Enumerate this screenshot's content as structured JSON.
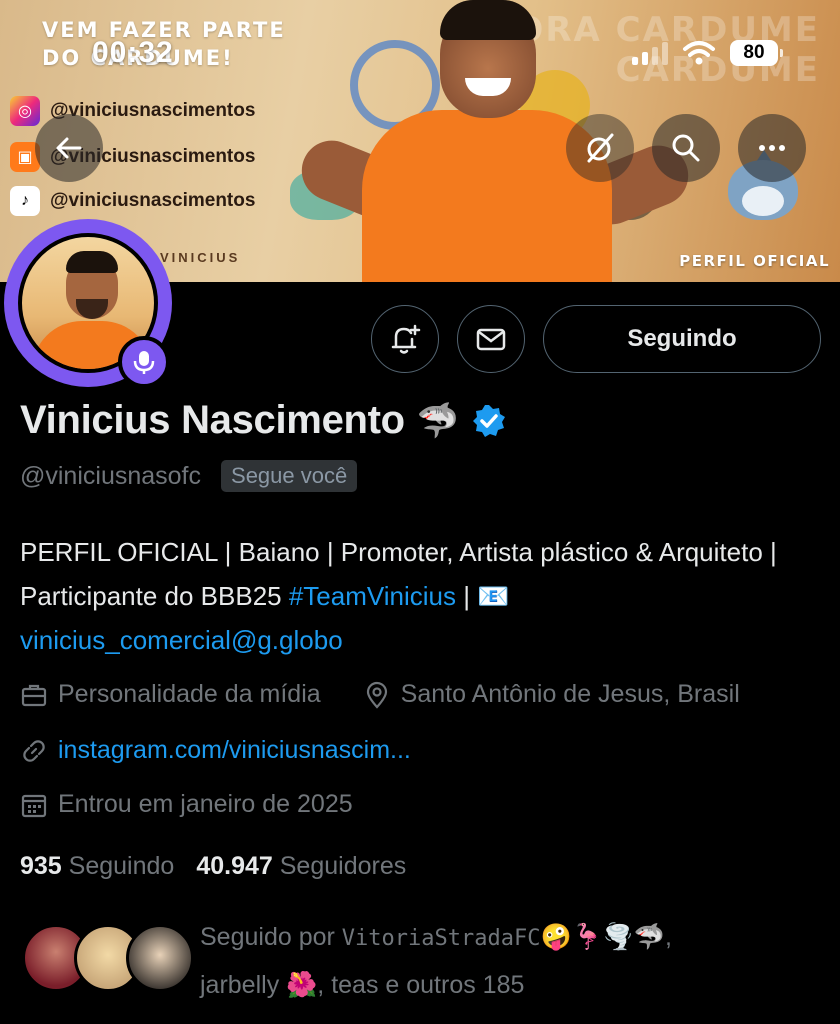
{
  "status_bar": {
    "time": "00:32",
    "battery": "80"
  },
  "banner": {
    "tagline_line1": "VEM FAZER PARTE",
    "tagline_line2": "DO CARDUME!",
    "watermark_line1": "BORA CARDUME",
    "watermark_line2": "CARDUME",
    "social": [
      {
        "network": "instagram-icon",
        "handle": "@viniciusnascimentos"
      },
      {
        "network": "kwai-icon",
        "handle": "@viniciusnascimentos"
      },
      {
        "network": "tiktok-icon",
        "handle": "@viniciusnascimentos"
      }
    ],
    "nickname": "VINICIUS",
    "badge_text": "PERFIL OFICIAL"
  },
  "profile": {
    "name": "Vinicius Nascimento",
    "name_emoji": "🦈",
    "handle": "@viniciusnasofc",
    "follows_you": "Segue você",
    "follow_button": "Seguindo",
    "bio_text": "PERFIL OFICIAL | Baiano | Promoter, Artista plástico & Arquiteto | Participante do BBB25 ",
    "bio_hashtag": "#TeamVinicius",
    "bio_sep": " | 📧",
    "bio_email": "vinicius_comercial@g.globo",
    "category": "Personalidade da mídia",
    "location": "Santo Antônio de Jesus, Brasil",
    "website": "instagram.com/viniciusnascim...",
    "joined": "Entrou em janeiro de 2025"
  },
  "stats": {
    "following_count": "935",
    "following_label": "Seguindo",
    "followers_count": "40.947",
    "followers_label": "Seguidores"
  },
  "followed_by": {
    "prefix": "Seguido por ",
    "user1": "VitoriaStradaFC",
    "user1_emojis": "🤪🦩🌪️🦈,",
    "user2": "jarbelly",
    "user2_emoji": "🌺",
    "rest": ", teas e outros 185"
  },
  "colors": {
    "accent": "#1d9bf0",
    "avatar_ring": "#7d58f0",
    "background": "#000000",
    "verified": "#1d9bf0"
  }
}
